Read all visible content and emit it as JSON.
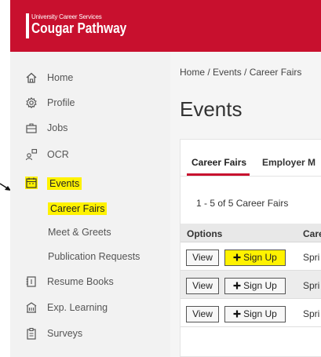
{
  "header": {
    "logo_sub": "University Career Services",
    "logo_name": "Cougar Pathway",
    "bg_color": "#c8102e"
  },
  "sidebar": {
    "items": [
      {
        "label": "Home",
        "icon": "home-icon"
      },
      {
        "label": "Profile",
        "icon": "gear-icon"
      },
      {
        "label": "Jobs",
        "icon": "briefcase-icon"
      },
      {
        "label": "OCR",
        "icon": "people-icon"
      },
      {
        "label": "Events",
        "icon": "calendar-icon",
        "highlighted": true
      },
      {
        "label": "Resume Books",
        "icon": "book-icon"
      },
      {
        "label": "Exp. Learning",
        "icon": "building-icon"
      },
      {
        "label": "Surveys",
        "icon": "clipboard-icon"
      }
    ],
    "event_subitems": [
      {
        "label": "Career Fairs",
        "highlighted": true
      },
      {
        "label": "Meet & Greets"
      },
      {
        "label": "Publication Requests"
      }
    ]
  },
  "main": {
    "breadcrumb": "Home / Events / Career Fairs",
    "title": "Events",
    "tabs": [
      {
        "label": "Career Fairs",
        "active": true
      },
      {
        "label": "Employer M"
      }
    ],
    "count_text": "1 - 5 of 5 Career Fairs",
    "table": {
      "headers": [
        "Options",
        "Care"
      ],
      "rows": [
        {
          "view": "View",
          "signup": "Sign Up",
          "name": "Spri",
          "highlighted": true
        },
        {
          "view": "View",
          "signup": "Sign Up",
          "name": "Spri"
        },
        {
          "view": "View",
          "signup": "Sign Up",
          "name": "Spri"
        }
      ]
    }
  },
  "colors": {
    "accent": "#c8102e",
    "highlight": "#fff200"
  }
}
